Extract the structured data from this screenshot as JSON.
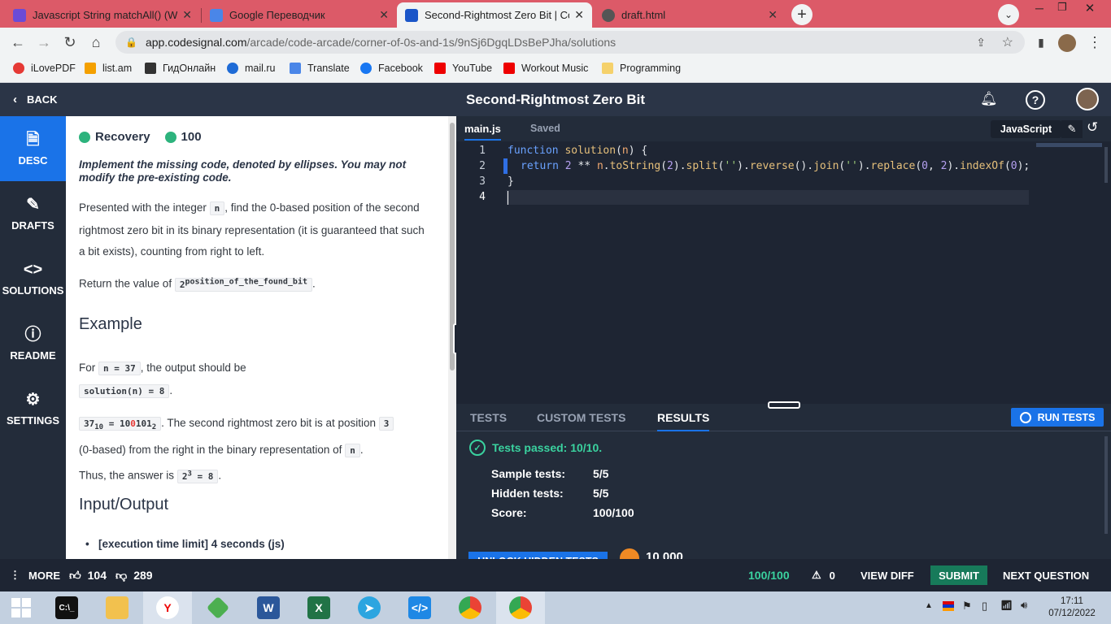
{
  "browser": {
    "tabs": [
      {
        "title": "Javascript String matchAll() (With",
        "color": "#6a4bd6"
      },
      {
        "title": "Google Переводчик",
        "color": "#4a86e8"
      },
      {
        "title": "Second-Rightmost Zero Bit | Cod",
        "color": "#1a55c8"
      },
      {
        "title": "draft.html",
        "color": "#555"
      }
    ],
    "url_domain": "app.codesignal.com",
    "url_path": "/arcade/code-arcade/corner-of-0s-and-1s/9nSj6DgqLDsBePJha/solutions",
    "bookmarks": [
      "iLovePDF",
      "list.am",
      "ГидОнлайн",
      "mail.ru",
      "Translate",
      "Facebook",
      "YouTube",
      "Workout Music",
      "Programming"
    ]
  },
  "header": {
    "back": "BACK",
    "title": "Second-Rightmost Zero Bit"
  },
  "sidebar": [
    {
      "label": "DESC",
      "icon": "document-icon"
    },
    {
      "label": "DRAFTS",
      "icon": "drafts-icon"
    },
    {
      "label": "SOLUTIONS",
      "icon": "code-icon"
    },
    {
      "label": "README",
      "icon": "info-icon"
    },
    {
      "label": "SETTINGS",
      "icon": "gear-icon"
    }
  ],
  "desc": {
    "category": "Recovery",
    "points": "100",
    "intro": "Implement the missing code, denoted by ellipses. You may not modify the pre-existing code.",
    "p1_a": "Presented with the integer",
    "p1_code": "n",
    "p1_b": ", find the 0-based position of the second rightmost zero bit in its binary representation (it is guaranteed that such a bit exists), counting from right to left.",
    "p2_a": "Return the value of",
    "p2_base": "2",
    "p2_sup": "position_of_the_found_bit",
    "p2_b": ".",
    "example_heading": "Example",
    "ex_a": "For",
    "ex_code1": "n = 37",
    "ex_b": ", the output should be",
    "ex_code2": "solution(n) = 8",
    "ex_c": ".",
    "ex2_left": "37",
    "ex2_left_sub": "10",
    "ex2_eq": " = 10",
    "ex2_red": "0",
    "ex2_tail": "101",
    "ex2_right_sub": "2",
    "ex2_text": ". The second rightmost zero bit is at position",
    "ex2_pos": "3",
    "ex3_a": "(0-based) from the right in the binary representation of",
    "ex3_code": "n",
    "ex3_b": ".",
    "ex4_a": "Thus, the answer is",
    "ex4_base": "2",
    "ex4_sup": "3",
    "ex4_tail": " = 8",
    "ex4_b": ".",
    "io_heading": "Input/Output",
    "io_item": "[execution time limit] 4 seconds (js)"
  },
  "editor": {
    "file": "main.js",
    "status": "Saved",
    "language": "JavaScript",
    "lines": [
      "1",
      "2",
      "3",
      "4"
    ]
  },
  "results": {
    "tabs": [
      "TESTS",
      "CUSTOM TESTS",
      "RESULTS"
    ],
    "run": "RUN TESTS",
    "passed": "Tests passed: 10/10.",
    "rows": [
      {
        "k": "Sample tests:",
        "v": "5/5"
      },
      {
        "k": "Hidden tests:",
        "v": "5/5"
      },
      {
        "k": "Score:",
        "v": "100/100"
      }
    ],
    "unlock": "UNLOCK HIDDEN TESTS",
    "coins": "10 000"
  },
  "bottom": {
    "more": "MORE",
    "likes": "104",
    "dislikes": "289",
    "score": "100/100",
    "warnings": "0",
    "view_diff": "VIEW DIFF",
    "submit": "SUBMIT",
    "next": "NEXT QUESTION"
  },
  "taskbar": {
    "time": "17:11",
    "date": "07/12/2022"
  }
}
